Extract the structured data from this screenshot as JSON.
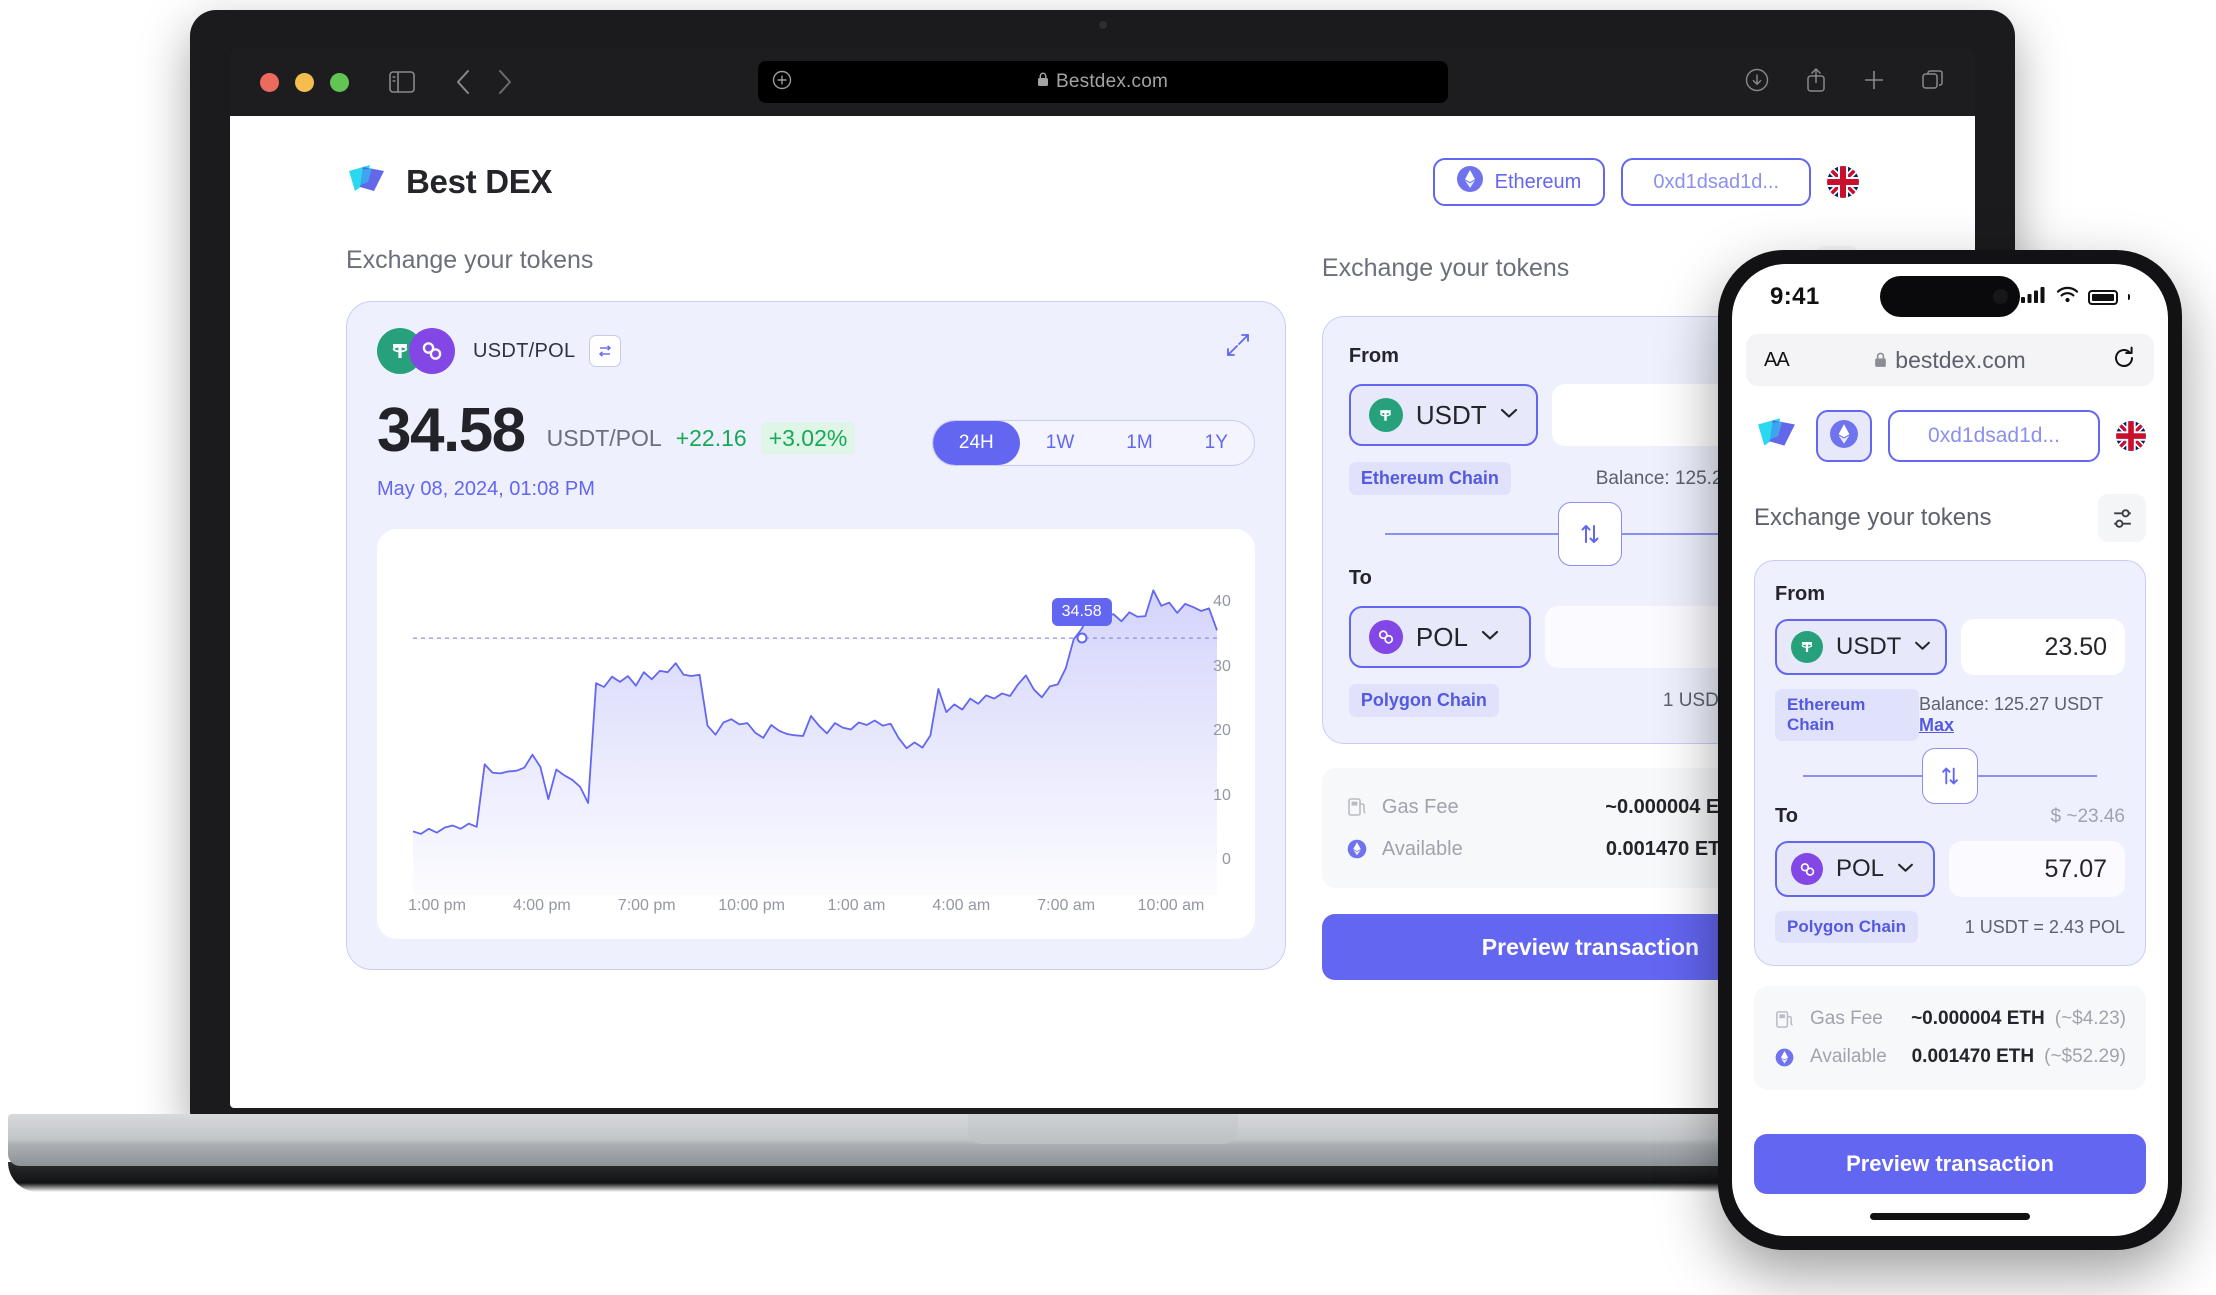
{
  "browser": {
    "url": "Bestdex.com",
    "lock_icon": "lock-icon",
    "window_controls": [
      "close",
      "minimize",
      "maximize"
    ],
    "toolbar_icons": [
      "sidebar-icon",
      "back-icon",
      "forward-icon",
      "plus-icon",
      "downloads-icon",
      "share-icon",
      "new-tab-icon",
      "tabs-icon"
    ]
  },
  "app": {
    "brand": "Best DEX",
    "header": {
      "network_label": "Ethereum",
      "wallet_address": "0xd1dsad1d...",
      "language_flag": "uk-flag-icon"
    }
  },
  "left_panel": {
    "title": "Exchange your tokens",
    "pair": "USDT/POL",
    "swap_pair_icon": "swap-horizontal-icon",
    "expand_icon": "expand-icon",
    "price": "34.58",
    "price_pair": "USDT/POL",
    "change_abs": "+22.16",
    "change_pct": "+3.02%",
    "timestamp": "May 08, 2024, 01:08 PM",
    "ranges": [
      "24H",
      "1W",
      "1M",
      "1Y"
    ],
    "active_range": "24H"
  },
  "chart_data": {
    "type": "area",
    "title": "USDT/POL 24H price",
    "xlabel": "",
    "ylabel": "",
    "grid": false,
    "legend": null,
    "tooltip_label": "34.58",
    "tooltip_x": "06:00 am",
    "reference_line_y": 34.58,
    "ylim": [
      0,
      45
    ],
    "yticks": [
      0,
      10,
      20,
      30,
      40
    ],
    "ytick_labels": [
      "0",
      "10",
      "20",
      "30",
      "40"
    ],
    "xticks": [
      "1:00 pm",
      "4:00 pm",
      "7:00 pm",
      "10:00 pm",
      "1:00 am",
      "4:00 am",
      "7:00 am",
      "10:00 am"
    ],
    "series": [
      {
        "name": "USDT/POL",
        "color": "#6366f1",
        "values": [
          4.6,
          4.2,
          5.0,
          4.4,
          5.2,
          5.5,
          5.0,
          5.8,
          5.3,
          15.0,
          13.7,
          13.6,
          13.9,
          14.0,
          14.5,
          16.5,
          14.6,
          9.6,
          14.2,
          13.3,
          12.6,
          11.5,
          9.0,
          27.6,
          27.0,
          28.6,
          27.8,
          28.7,
          27.2,
          29.3,
          28.2,
          29.5,
          29.3,
          30.7,
          28.9,
          28.7,
          28.9,
          21.0,
          19.6,
          21.5,
          22.0,
          21.2,
          21.4,
          19.9,
          19.1,
          21.1,
          20.2,
          19.7,
          19.5,
          19.4,
          22.5,
          21.0,
          19.8,
          21.4,
          20.7,
          20.4,
          21.5,
          21.1,
          21.8,
          21.0,
          21.3,
          19.1,
          17.5,
          18.4,
          17.6,
          19.5,
          26.7,
          23.1,
          24.3,
          23.5,
          25.2,
          24.4,
          25.7,
          25.2,
          26.0,
          25.6,
          27.4,
          28.8,
          26.6,
          25.4,
          27.1,
          27.4,
          29.9,
          34.4,
          36.0,
          38.5,
          37.5,
          38.1,
          38.3,
          37.2,
          38.6,
          37.9,
          38.0,
          42.0,
          39.6,
          40.1,
          38.5,
          39.9,
          39.4,
          38.8,
          39.2,
          35.8
        ]
      }
    ]
  },
  "right_panel": {
    "title": "Exchange your tokens",
    "settings_icon": "settings-sliders-icon",
    "from": {
      "label": "From",
      "token": "USDT",
      "token_icon": "usdt-icon",
      "chevron": "chevron-down-icon",
      "amount": "23.50",
      "chain": "Ethereum Chain",
      "balance": "Balance: 125.27 USDT",
      "max_label": "Max"
    },
    "swap_direction_icon": "swap-vertical-icon",
    "to": {
      "label": "To",
      "usd_estimate": "$ ~23.46",
      "token": "POL",
      "token_icon": "pol-icon",
      "chevron": "chevron-down-icon",
      "amount": "57.07",
      "chain": "Polygon Chain",
      "rate": "1 USDT = 2.43 POL"
    },
    "fees": [
      {
        "icon": "gas-pump-icon",
        "name": "Gas Fee",
        "value": "~0.000004 ETH",
        "usd": "(~$4.23)"
      },
      {
        "icon": "ethereum-icon",
        "name": "Available",
        "value": "0.001470 ETH",
        "usd": "(~$52.29)"
      }
    ],
    "preview_button": "Preview transaction"
  },
  "phone": {
    "status": {
      "time": "9:41",
      "cellular": "signal-icon",
      "wifi": "wifi-icon",
      "battery": "battery-icon"
    },
    "safari": {
      "text_size": "AA",
      "url": "bestdex.com",
      "lock": "lock-icon",
      "reload": "reload-icon"
    },
    "header": {
      "network_icon": "ethereum-icon",
      "wallet_address": "0xd1dsad1d...",
      "language_flag": "uk-flag-icon"
    },
    "title": "Exchange your tokens",
    "settings_icon": "settings-sliders-icon",
    "from": {
      "label": "From",
      "token": "USDT",
      "amount": "23.50",
      "chain": "Ethereum Chain",
      "balance": "Balance: 125.27 USDT",
      "max_label": "Max"
    },
    "to": {
      "label": "To",
      "usd_estimate": "$ ~23.46",
      "token": "POL",
      "amount": "57.07",
      "chain": "Polygon Chain",
      "rate": "1 USDT = 2.43 POL"
    },
    "fees": [
      {
        "icon": "gas-pump-icon",
        "name": "Gas Fee",
        "value": "~0.000004 ETH",
        "usd": "(~$4.23)"
      },
      {
        "icon": "ethereum-icon",
        "name": "Available",
        "value": "0.001470 ETH",
        "usd": "(~$52.29)"
      }
    ],
    "preview_button": "Preview transaction"
  },
  "colors": {
    "accent": "#6366f1",
    "panel_bg": "#eef0fd",
    "positive": "#18a957",
    "usdt": "#26a17b",
    "pol": "#8247e5"
  }
}
